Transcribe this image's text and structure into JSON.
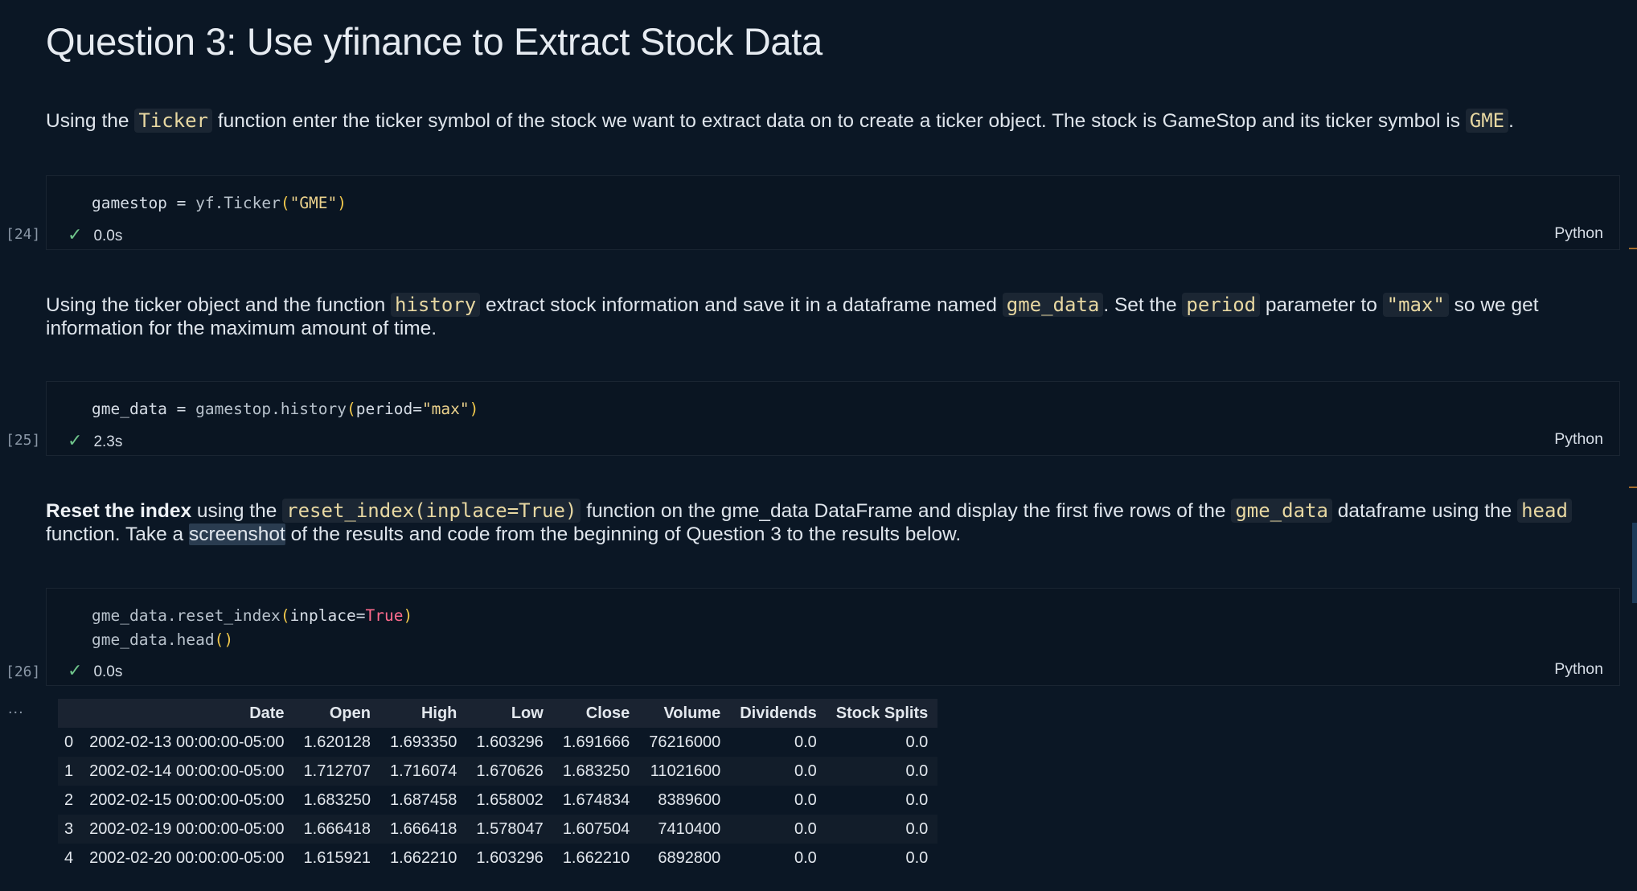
{
  "heading": "Question 3: Use yfinance to Extract Stock Data",
  "md1": {
    "t1": "Using the ",
    "c1": "Ticker",
    "t2": " function enter the ticker symbol of the stock we want to extract data on to create a ticker object. The stock is GameStop and its ticker symbol is ",
    "c2": "GME",
    "t3": "."
  },
  "cell1": {
    "code": {
      "var": "gamestop",
      "eq": " = ",
      "obj": "yf.Ticker",
      "open": "(",
      "str": "\"GME\"",
      "close": ")"
    },
    "exec_count": "[24]",
    "time": "0.0s",
    "lang": "Python"
  },
  "md2": {
    "t1": "Using the ticker object and the function ",
    "c1": "history",
    "t2": " extract stock information and save it in a dataframe named ",
    "c2": "gme_data",
    "t3": ". Set the ",
    "c3": "period",
    "t4": " parameter to ",
    "c4": "\"max\"",
    "t5": " so we get information for the maximum amount of time."
  },
  "cell2": {
    "code": {
      "var": "gme_data",
      "eq": " = ",
      "obj": "gamestop.history",
      "open": "(",
      "arg": "period=",
      "str": "\"max\"",
      "close": ")"
    },
    "exec_count": "[25]",
    "time": "2.3s",
    "lang": "Python"
  },
  "md3": {
    "bold": "Reset the index",
    "t1": " using the ",
    "c1": "reset_index(inplace=True)",
    "t2": " function on the gme_data DataFrame and display the first five rows of the ",
    "c2": "gme_data",
    "t3": " dataframe using the ",
    "c3": "head",
    "t4": " function. Take a ",
    "hl": "screenshot",
    "t5": " of the results and code from the beginning of Question 3 to the results below."
  },
  "cell3": {
    "line1": {
      "obj": "gme_data.reset_index",
      "open": "(",
      "arg": "inplace=",
      "kw": "True",
      "close": ")"
    },
    "line2": {
      "obj": "gme_data.head",
      "parens": "()"
    },
    "exec_count": "[26]",
    "time": "0.0s",
    "lang": "Python"
  },
  "output": {
    "more": "...",
    "columns": [
      "",
      "Date",
      "Open",
      "High",
      "Low",
      "Close",
      "Volume",
      "Dividends",
      "Stock Splits"
    ],
    "rows": [
      [
        "0",
        "2002-02-13 00:00:00-05:00",
        "1.620128",
        "1.693350",
        "1.603296",
        "1.691666",
        "76216000",
        "0.0",
        "0.0"
      ],
      [
        "1",
        "2002-02-14 00:00:00-05:00",
        "1.712707",
        "1.716074",
        "1.670626",
        "1.683250",
        "11021600",
        "0.0",
        "0.0"
      ],
      [
        "2",
        "2002-02-15 00:00:00-05:00",
        "1.683250",
        "1.687458",
        "1.658002",
        "1.674834",
        "8389600",
        "0.0",
        "0.0"
      ],
      [
        "3",
        "2002-02-19 00:00:00-05:00",
        "1.666418",
        "1.666418",
        "1.578047",
        "1.607504",
        "7410400",
        "0.0",
        "0.0"
      ],
      [
        "4",
        "2002-02-20 00:00:00-05:00",
        "1.615921",
        "1.662210",
        "1.603296",
        "1.662210",
        "6892800",
        "0.0",
        "0.0"
      ]
    ]
  },
  "icons": {
    "check": "checkmark-icon"
  },
  "colors": {
    "background": "#0b1725",
    "string": "#ecd28c",
    "keyword": "#ff6b8d",
    "paren": "#f2c94c",
    "success": "#6fc48b"
  }
}
